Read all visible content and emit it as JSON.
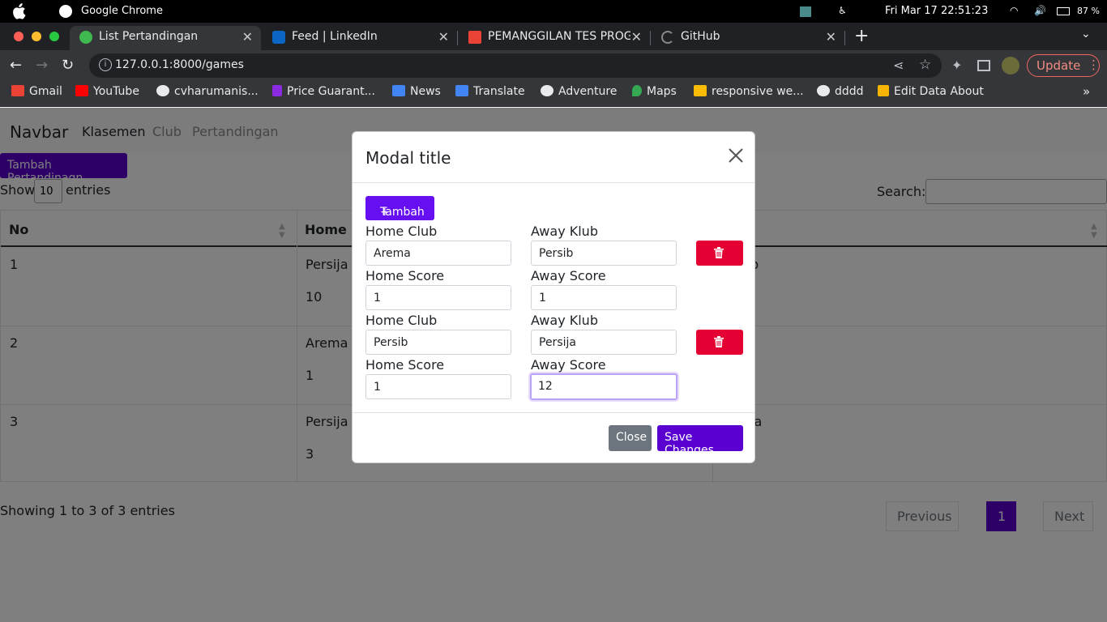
{
  "system": {
    "app_name": "Google Chrome",
    "datetime": "Fri Mar 17  22:51:23",
    "battery": "87 %"
  },
  "tabs": [
    {
      "label": "List Pertandingan",
      "icon_color": "#3fb950"
    },
    {
      "label": "Feed | LinkedIn",
      "icon_color": "#0a66c2"
    },
    {
      "label": "PEMANGGILAN TES PROG",
      "icon_color": "#ea4335"
    },
    {
      "label": "GitHub",
      "icon_color": "#888888"
    }
  ],
  "toolbar": {
    "url": "127.0.0.1:8000/games",
    "update_label": "Update"
  },
  "bookmarks": [
    {
      "label": "Gmail",
      "icon_color": "#ea4335"
    },
    {
      "label": "YouTube",
      "icon_color": "#ff0000"
    },
    {
      "label": "cvharumanis...",
      "icon_color": "#e8eaed"
    },
    {
      "label": "Price Guarant...",
      "icon_color": "#8a2be2"
    },
    {
      "label": "News",
      "icon_color": "#4285f4"
    },
    {
      "label": "Translate",
      "icon_color": "#4285f4"
    },
    {
      "label": "Adventure",
      "icon_color": "#e8eaed"
    },
    {
      "label": "Maps",
      "icon_color": "#34a853"
    },
    {
      "label": "responsive we...",
      "icon_color": "#fbbc04"
    },
    {
      "label": "dddd",
      "icon_color": "#e8eaed"
    },
    {
      "label": "Edit Data About",
      "icon_color": "#f4b400"
    }
  ],
  "navbar": {
    "brand": "Navbar",
    "links": [
      "Klasemen",
      "Club",
      "Pertandingan"
    ]
  },
  "page": {
    "add_button": "Tambah Pertandinagn",
    "show_label": "Show",
    "entries_value": "10",
    "entries_label": "entries",
    "search_label": "Search:",
    "columns": [
      "No",
      "Home"
    ],
    "rows": [
      {
        "no": "1",
        "home": "Persija",
        "score": "10",
        "right": "b"
      },
      {
        "no": "2",
        "home": "Arema",
        "score": "1",
        "right": ""
      },
      {
        "no": "3",
        "home": "Persija",
        "score": "3",
        "right": "ja"
      }
    ],
    "info": "Showing 1 to 3 of 3 entries",
    "pagination": {
      "previous": "Previous",
      "current": "1",
      "next": "Next"
    }
  },
  "modal": {
    "title": "Modal title",
    "add_label": "Tambah",
    "add_symbol": "+",
    "games": [
      {
        "home_club_label": "Home Club",
        "home_club": "Arema",
        "away_club_label": "Away Klub",
        "away_club": "Persib",
        "home_score_label": "Home Score",
        "home_score": "1",
        "away_score_label": "Away Score",
        "away_score": "1"
      },
      {
        "home_club_label": "Home Club",
        "home_club": "Persib",
        "away_club_label": "Away Klub",
        "away_club": "Persija",
        "home_score_label": "Home Score",
        "home_score": "1",
        "away_score_label": "Away Score",
        "away_score": "12"
      }
    ],
    "close_label": "Close",
    "save_label": "Save Changes"
  },
  "colors": {
    "primary": "#5a00d1",
    "tambah": "#6610f2",
    "danger": "#e40033",
    "secondary": "#6c757d"
  }
}
